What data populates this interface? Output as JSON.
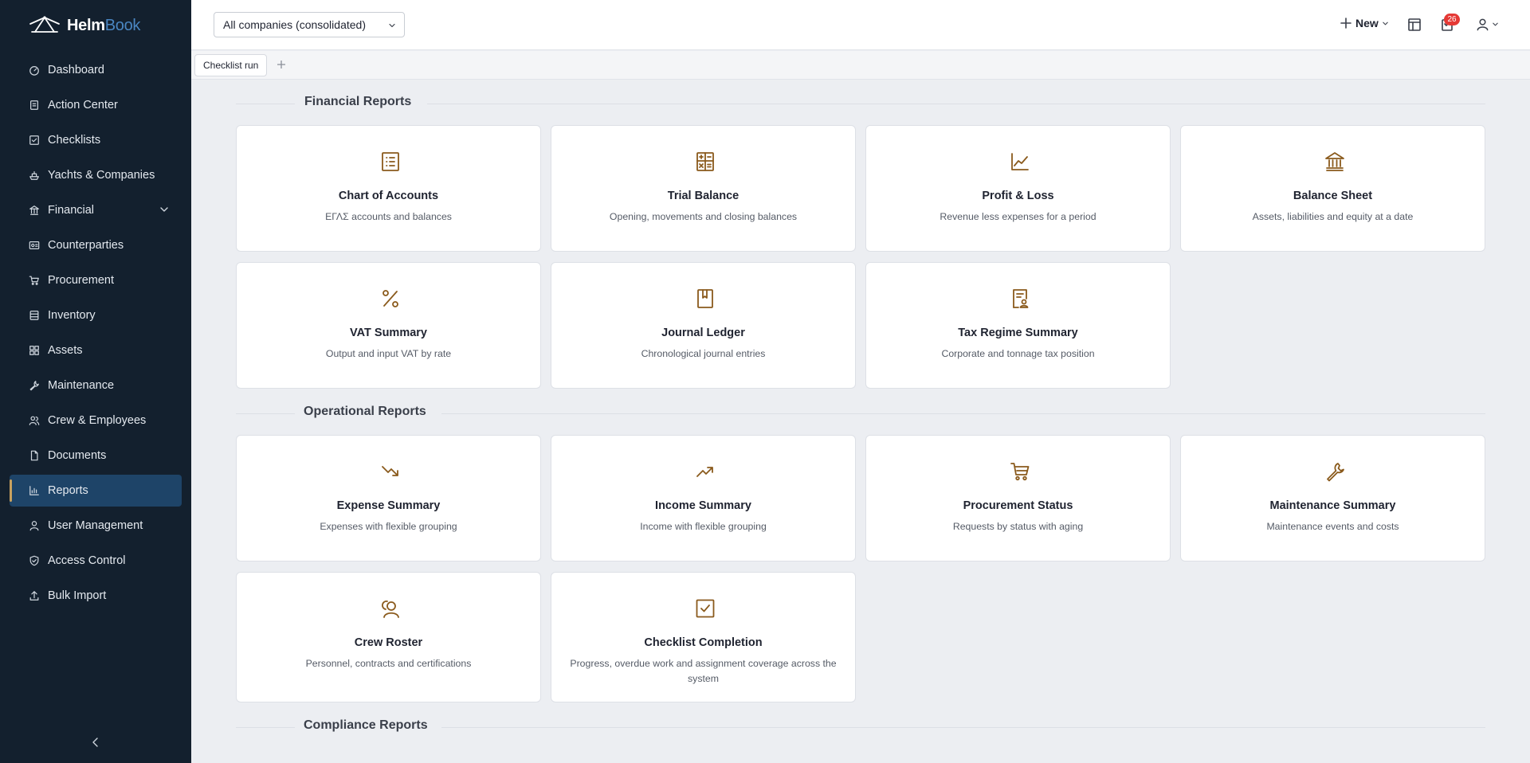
{
  "app": {
    "logo_part1": "Helm",
    "logo_part2": "Book"
  },
  "sidebar": {
    "items": [
      {
        "label": "Dashboard",
        "icon": "dashboard-icon"
      },
      {
        "label": "Action Center",
        "icon": "clipboard-icon"
      },
      {
        "label": "Checklists",
        "icon": "checkbox-icon"
      },
      {
        "label": "Yachts & Companies",
        "icon": "ship-icon"
      },
      {
        "label": "Financial",
        "icon": "bank-icon",
        "expandable": true
      },
      {
        "label": "Counterparties",
        "icon": "id-card-icon"
      },
      {
        "label": "Procurement",
        "icon": "cart-icon"
      },
      {
        "label": "Inventory",
        "icon": "box-icon"
      },
      {
        "label": "Assets",
        "icon": "grid-icon"
      },
      {
        "label": "Maintenance",
        "icon": "wrench-icon"
      },
      {
        "label": "Crew & Employees",
        "icon": "users-icon"
      },
      {
        "label": "Documents",
        "icon": "file-icon"
      },
      {
        "label": "Reports",
        "icon": "bar-chart-icon",
        "active": true
      },
      {
        "label": "User Management",
        "icon": "user-icon"
      },
      {
        "label": "Access Control",
        "icon": "shield-icon"
      },
      {
        "label": "Bulk Import",
        "icon": "upload-icon"
      }
    ]
  },
  "topbar": {
    "company_select": "All companies (consolidated)",
    "new_label": "New",
    "notifications_count": "26"
  },
  "tabs": {
    "items": [
      {
        "label": "Checklist run"
      }
    ]
  },
  "sections": {
    "financial": {
      "title": "Financial Reports",
      "cards": [
        {
          "title": "Chart of Accounts",
          "desc": "ΕΓΛΣ accounts and balances",
          "icon": "list-icon"
        },
        {
          "title": "Trial Balance",
          "desc": "Opening, movements and closing balances",
          "icon": "calculator-icon"
        },
        {
          "title": "Profit & Loss",
          "desc": "Revenue less expenses for a period",
          "icon": "line-chart-icon"
        },
        {
          "title": "Balance Sheet",
          "desc": "Assets, liabilities and equity at a date",
          "icon": "bank-icon"
        },
        {
          "title": "VAT Summary",
          "desc": "Output and input VAT by rate",
          "icon": "percent-icon"
        },
        {
          "title": "Journal Ledger",
          "desc": "Chronological journal entries",
          "icon": "book-icon"
        },
        {
          "title": "Tax Regime Summary",
          "desc": "Corporate and tonnage tax position",
          "icon": "tax-document-icon"
        }
      ]
    },
    "operational": {
      "title": "Operational Reports",
      "cards": [
        {
          "title": "Expense Summary",
          "desc": "Expenses with flexible grouping",
          "icon": "trending-down-icon"
        },
        {
          "title": "Income Summary",
          "desc": "Income with flexible grouping",
          "icon": "trending-up-icon"
        },
        {
          "title": "Procurement Status",
          "desc": "Requests by status with aging",
          "icon": "cart-icon"
        },
        {
          "title": "Maintenance Summary",
          "desc": "Maintenance events and costs",
          "icon": "wrench-icon"
        },
        {
          "title": "Crew Roster",
          "desc": "Personnel, contracts and certifications",
          "icon": "crew-icon"
        },
        {
          "title": "Checklist Completion",
          "desc": "Progress, overdue work and assignment coverage across the system",
          "icon": "check-square-icon"
        }
      ]
    },
    "compliance": {
      "title": "Compliance Reports"
    }
  },
  "colors": {
    "sidebar_bg": "#13202e",
    "active_bg": "#1e4468",
    "accent": "#c8a15e",
    "icon_brown": "#8a5a1c",
    "badge": "#e53935"
  }
}
